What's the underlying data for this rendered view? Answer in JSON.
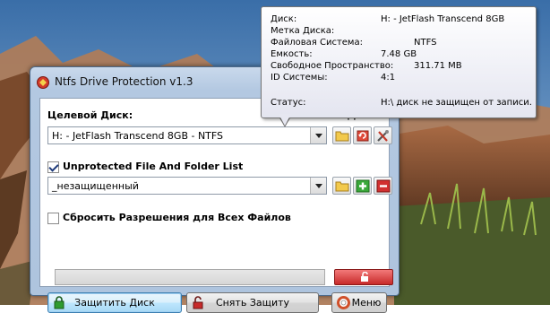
{
  "window": {
    "title": "Ntfs Drive Protection v1.3"
  },
  "target": {
    "label": "Целевой Диск:",
    "hidden_label": "Защитить Все Диски",
    "selected_drive": "H: - JetFlash Transcend 8GB - NTFS"
  },
  "unprotected": {
    "checked": true,
    "label": "Unprotected File And Folder List",
    "selected": "_незащищенный"
  },
  "reset": {
    "checked": false,
    "label": "Сбросить Разрешения для Всех Файлов"
  },
  "progress": {
    "value": 0
  },
  "buttons": {
    "protect": "Защитить Диск",
    "unprotect": "Снять Защиту",
    "menu": "Меню"
  },
  "tooltip": {
    "disk_key": "Диск:",
    "disk_val": "H: - JetFlash Transcend 8GB",
    "label_key": "Метка Диска:",
    "label_val": "",
    "fs_key": "Файловая Система:",
    "fs_val": "NTFS",
    "capacity_key": "Емкость:",
    "capacity_val": "7.48 GB",
    "free_key": "Свободное Пространство:",
    "free_val": "311.71 MB",
    "id_key": "ID Системы:",
    "id_val": "4:1",
    "status_key": "Статус:",
    "status_val": "H:\\ диск не защищен от записи."
  },
  "colors": {
    "protect_green": "#2e9b2e",
    "unprotect_red": "#c72a2a",
    "add_green": "#3aa83a",
    "remove_red": "#d23030"
  },
  "icons": [
    "app-icon",
    "folder-icon",
    "refresh-icon",
    "tools-icon",
    "folder-icon",
    "plus-icon",
    "minus-icon",
    "lock-icon",
    "unlock-icon",
    "lifebuoy-icon"
  ]
}
